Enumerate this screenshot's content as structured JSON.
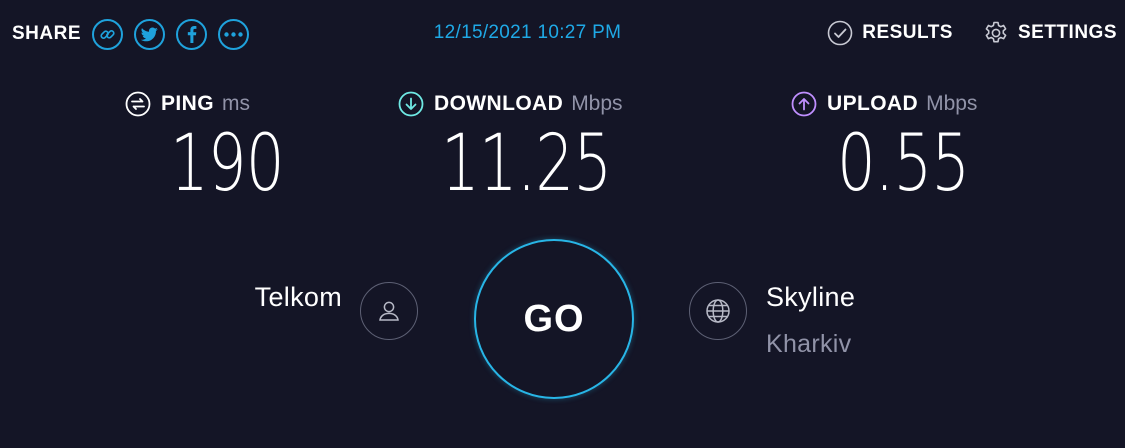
{
  "header": {
    "share_label": "SHARE",
    "share_buttons": [
      {
        "name": "link",
        "icon": "link-icon"
      },
      {
        "name": "twitter",
        "icon": "twitter-icon"
      },
      {
        "name": "facebook",
        "icon": "facebook-icon"
      },
      {
        "name": "more",
        "icon": "more-icon"
      }
    ],
    "timestamp": "12/15/2021 10:27 PM",
    "results_label": "RESULTS",
    "settings_label": "SETTINGS"
  },
  "metrics": {
    "ping": {
      "label": "PING",
      "unit": "ms",
      "value": "190",
      "icon": "ping-icon"
    },
    "download": {
      "label": "DOWNLOAD",
      "unit": "Mbps",
      "value": "11.25",
      "icon": "download-arrow-icon",
      "color": "#6fe9e4"
    },
    "upload": {
      "label": "UPLOAD",
      "unit": "Mbps",
      "value": "0.55",
      "icon": "upload-arrow-icon",
      "color": "#c08fff"
    }
  },
  "provider": {
    "name": "Telkom",
    "icon": "user-icon"
  },
  "go_button": {
    "label": "GO"
  },
  "server": {
    "name": "Skyline",
    "location": "Kharkiv",
    "icon": "globe-icon"
  },
  "colors": {
    "background": "#141526",
    "accent": "#1fa2dc",
    "muted_text": "#9193a8"
  }
}
